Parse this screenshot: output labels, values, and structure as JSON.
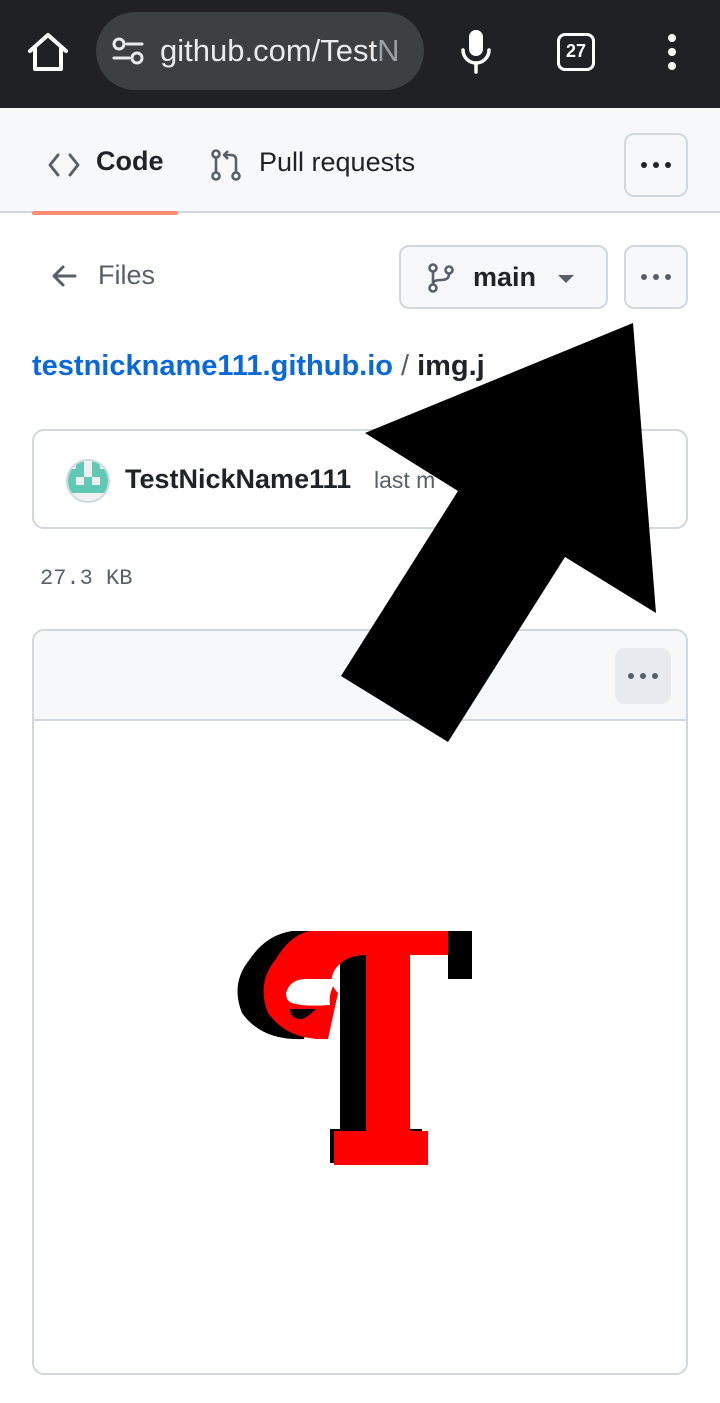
{
  "browser": {
    "url_visible": "github.com/Test",
    "url_overflow": "N",
    "tab_count": "27"
  },
  "repo_nav": {
    "code_label": "Code",
    "pulls_label": "Pull requests"
  },
  "file_header": {
    "back_label": "Files",
    "branch": "main"
  },
  "breadcrumb": {
    "repo": "testnickname111.github.io",
    "separator": "/",
    "file": "img.j"
  },
  "commit": {
    "author": "TestNickName111",
    "meta": "last m"
  },
  "file": {
    "size": "27.3 KB"
  },
  "colors": {
    "accent_underline": "#fd8c73",
    "link": "#0969da",
    "preview_red": "#ff0000",
    "preview_shadow": "#000000"
  }
}
